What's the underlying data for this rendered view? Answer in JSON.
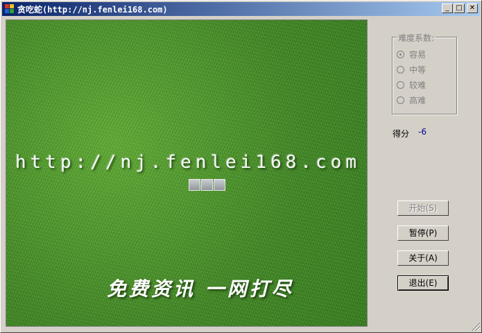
{
  "window": {
    "title": "贪吃蛇(http://nj.fenlei168.com)",
    "controls": {
      "minimize": "_",
      "maximize": "□",
      "close": "✕"
    }
  },
  "game": {
    "url_watermark": "http://nj.fenlei168.com",
    "slogan": "免费资讯 一网打尽",
    "snake_segments": 3
  },
  "difficulty": {
    "title": "难度系数:",
    "options": [
      {
        "label": "容易",
        "checked": true
      },
      {
        "label": "中等",
        "checked": false
      },
      {
        "label": "较难",
        "checked": false
      },
      {
        "label": "高难",
        "checked": false
      }
    ]
  },
  "score": {
    "label": "得分",
    "value": "-6"
  },
  "buttons": {
    "start": "开始(S)",
    "pause": "暂停(P)",
    "about": "关于(A)",
    "exit": "退出(E)"
  },
  "colors": {
    "title_bar_start": "#0a246a",
    "title_bar_end": "#a6caf0",
    "score_color": "#0000a0",
    "grass": "#4a8f2a"
  }
}
